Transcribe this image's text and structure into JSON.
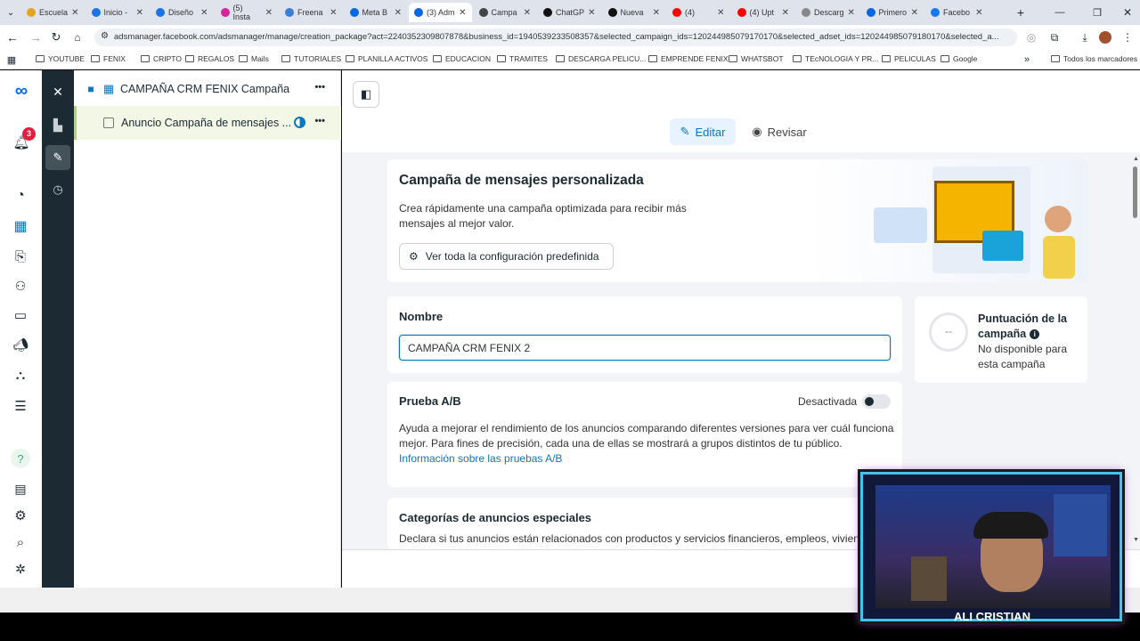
{
  "browser": {
    "tabs": [
      {
        "label": "Escuela",
        "color": "#e6a31a"
      },
      {
        "label": "Inicio -",
        "color": "#1a73e8"
      },
      {
        "label": "Diseño",
        "color": "#1a73e8"
      },
      {
        "label": "(5) Insta",
        "color": "#d6249f"
      },
      {
        "label": "Freena",
        "color": "#3b7ed8"
      },
      {
        "label": "Meta B",
        "color": "#0668e1"
      },
      {
        "label": "(3) Adm",
        "color": "#0668e1"
      },
      {
        "label": "Campa",
        "color": "#444"
      },
      {
        "label": "ChatGP",
        "color": "#111"
      },
      {
        "label": "Nueva",
        "color": "#111"
      },
      {
        "label": "(4)",
        "color": "#ff0000"
      },
      {
        "label": "(4) Upt",
        "color": "#ff0000"
      },
      {
        "label": "Descarg",
        "color": "#888"
      },
      {
        "label": "Primero",
        "color": "#0668e1"
      },
      {
        "label": "Facebo",
        "color": "#1877f2"
      }
    ],
    "url": "adsmanager.facebook.com/adsmanager/manage/creation_package?act=2240352309807878&business_id=1940539233508357&selected_campaign_ids=120244985079170170&selected_adset_ids=120244985079180170&selected_a...",
    "bookmarks": [
      "YOUTUBE",
      "FENIX",
      "CRIPTO",
      "REGALOS",
      "Mails",
      "TUTORIALES",
      "PLANILLA ACTIVOS",
      "EDUCACION",
      "TRAMITES",
      "DESCARGA PELICU...",
      "EMPRENDE FENIX",
      "WHATSBOT",
      "TEcNOLOGIA Y PR...",
      "PELICULAS",
      "Google"
    ],
    "bookmarks_more": "Todos los marcadores"
  },
  "rail": {
    "notification_count": "3"
  },
  "tree": {
    "campaign_name": "CAMPAÑA CRM FENIX Campaña",
    "ad_name": "Anuncio Campaña de mensajes ...",
    "more": "•••"
  },
  "modes": {
    "edit_label": "Editar",
    "review_label": "Revisar"
  },
  "hero": {
    "title": "Campaña de mensajes personalizada",
    "desc_line1": "Crea rápidamente una campaña optimizada para recibir más",
    "desc_line2": "mensajes al mejor valor.",
    "config_button": "Ver toda la configuración predefinida"
  },
  "name_section": {
    "label": "Nombre",
    "value": "CAMPAÑA CRM FENIX 2"
  },
  "score": {
    "title_line1": "Puntuación de la",
    "title_line2": "campaña",
    "value": "--",
    "desc_line1": "No disponible para",
    "desc_line2": "esta campaña"
  },
  "ab_test": {
    "title": "Prueba A/B",
    "status": "Desactivada",
    "enabled": false,
    "desc_line1": "Ayuda a mejorar el rendimiento de los anuncios comparando diferentes versiones para ver cuál funciona",
    "desc_line2": "mejor. Para fines de precisión, cada una de ellas se mostrará a grupos distintos de tu público.",
    "link": "Información sobre las pruebas A/B"
  },
  "special_categories": {
    "title": "Categorías de anuncios especiales",
    "desc": "Declara si tus anuncios están relacionados con productos y servicios financieros, empleos, viviend"
  },
  "webcam": {
    "name": "ALI CRISTIAN"
  },
  "colors": {
    "accent": "#0a78be",
    "dark_rail": "#1c2b33",
    "edit_bg": "#e7f3ff"
  }
}
